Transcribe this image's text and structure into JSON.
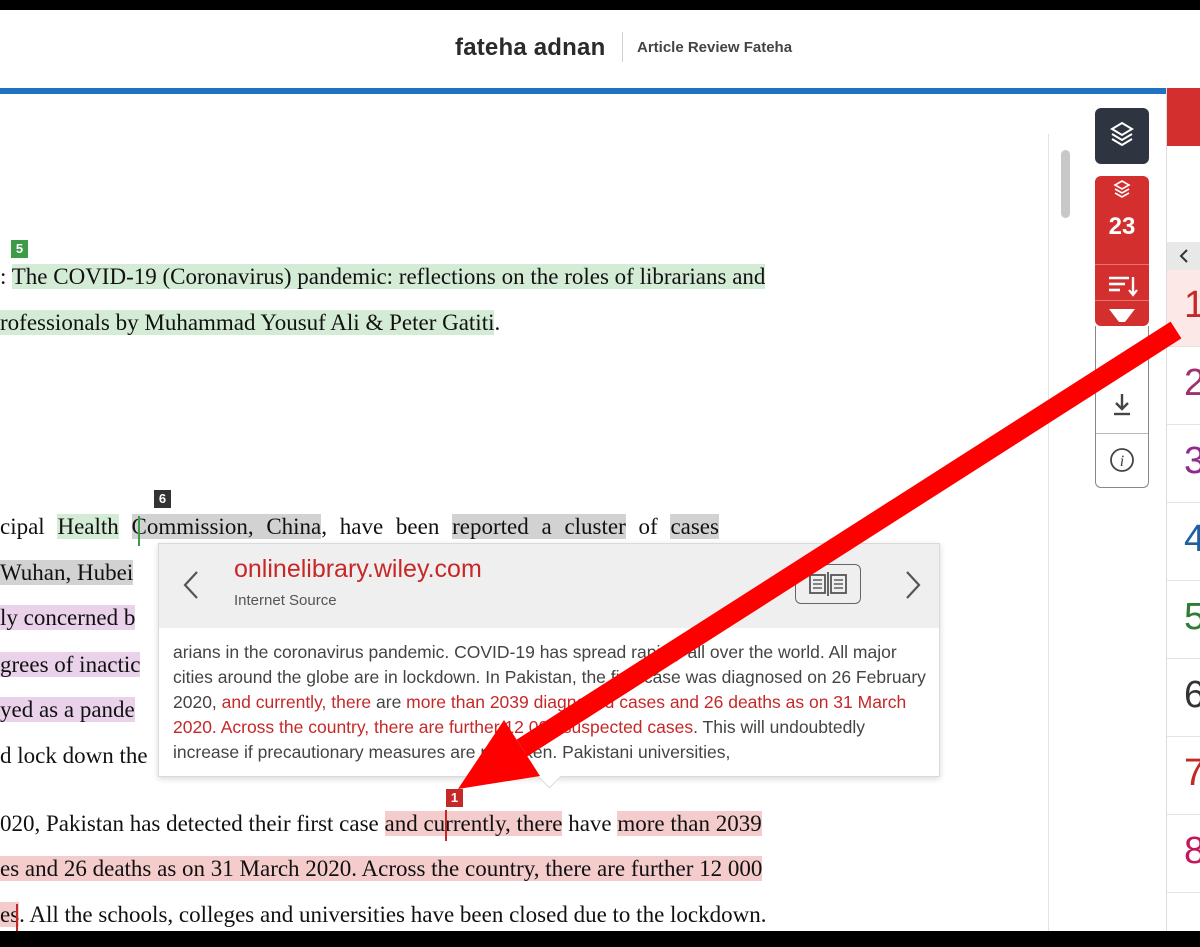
{
  "header": {
    "author": "fateha adnan",
    "document_title": "Article Review Fateha"
  },
  "document": {
    "line1": {
      "prefix": ": ",
      "highlight": "The COVID-19 (Coronavirus) pandemic: reflections on the roles of librarians and"
    },
    "line2": {
      "highlight": "rofessionals by Muhammad Yousuf Ali & Peter Gatiti",
      "suffix": "."
    },
    "line3": {
      "pre": "cipal ",
      "health": "Health",
      "sp1": " ",
      "commission": "Commission, China",
      "mid": ", have been ",
      "reported": "reported a cluster",
      "of": " of ",
      "cases": "cases"
    },
    "line4": {
      "text": "Wuhan, Hubei"
    },
    "line5": {
      "text": "ly concerned b"
    },
    "line6": {
      "text": "grees of inactic"
    },
    "line7": {
      "text": "yed as a pande"
    },
    "line8": {
      "text": "d lock down the"
    },
    "line9": {
      "pre": "020, Pakistan has detected their first case ",
      "hl1": "and currently, there",
      "mid": " have ",
      "hl2": "more than 2039"
    },
    "line10": {
      "highlight": "es and 26 deaths as on 31 March 2020. Across the country, there are further 12 000"
    },
    "line11": {
      "highlight": "es",
      "suffix": ". All the schools, colleges and universities have been closed due to the lockdown."
    },
    "tags": {
      "t5": "5",
      "t6": "6",
      "t1": "1"
    }
  },
  "popup": {
    "source": "onlinelibrary.wiley.com",
    "source_type": "Internet Source",
    "text": {
      "a": "arians in the coronavirus pandemic. COVID-19 has spread rapidly all over the world. All major cities around the globe are in lockdown. In Pakistan, the first case was diagnosed on 26 February 2020, ",
      "b": "and currently, there",
      "c": " are ",
      "d": "more than 2039 diagnosed cases and 26 deaths as on 31 March 2020. Across the country, there are further 12 000 suspected cases",
      "e": ". This will undoubtedly increase if precautionary measures are not taken. Pakistani universities,"
    }
  },
  "toolbar": {
    "match_count": "23"
  },
  "match_panel": {
    "items": [
      {
        "num": "1",
        "color": "#c62828"
      },
      {
        "num": "2",
        "color": "#a0306e"
      },
      {
        "num": "3",
        "color": "#8e2a8e"
      },
      {
        "num": "4",
        "color": "#1f5fa0"
      },
      {
        "num": "5",
        "color": "#2e7d32"
      },
      {
        "num": "6",
        "color": "#333333"
      },
      {
        "num": "7",
        "color": "#c62828"
      },
      {
        "num": "8",
        "color": "#c2185b"
      }
    ]
  },
  "colors": {
    "accent_blue": "#1f73c1",
    "match_red": "#c62828",
    "toolbar_dark": "#2e3440",
    "annotation_arrow": "#ff0000"
  }
}
